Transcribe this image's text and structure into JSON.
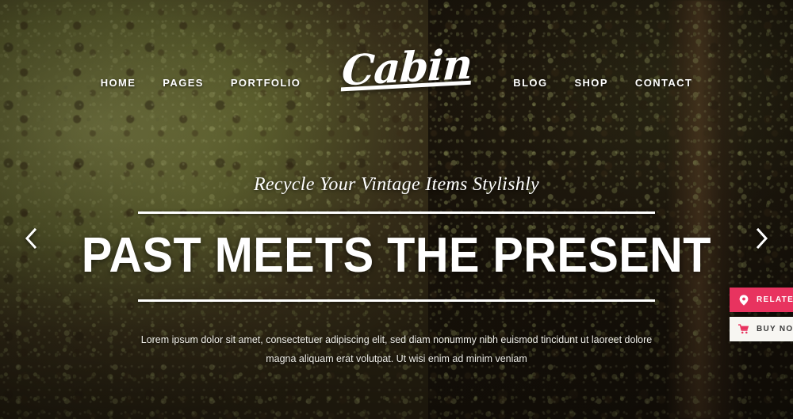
{
  "site": {
    "brand": "Cabin"
  },
  "colors": {
    "accent_pink": "#e8335f",
    "buy_bg": "#f7f6f2",
    "buy_text": "#3a3a3a",
    "text_white": "#ffffff"
  },
  "header": {
    "nav_left": [
      {
        "label": "HOME",
        "name": "nav-item-home"
      },
      {
        "label": "PAGES",
        "name": "nav-item-pages"
      },
      {
        "label": "PORTFOLIO",
        "name": "nav-item-portfolio"
      }
    ],
    "nav_right": [
      {
        "label": "BLOG",
        "name": "nav-item-blog"
      },
      {
        "label": "SHOP",
        "name": "nav-item-shop"
      },
      {
        "label": "CONTACT",
        "name": "nav-item-contact"
      }
    ]
  },
  "slide": {
    "tagline": "Recycle Your Vintage Items Stylishly",
    "title": "PAST MEETS THE PRESENT",
    "description": "Lorem ipsum dolor sit amet, consectetuer adipiscing elit, sed diam nonummy nibh euismod tincidunt ut laoreet dolore magna aliquam erat volutpat. Ut wisi enim ad minim veniam"
  },
  "slider_controls": {
    "prev_icon": "chevron-left-icon",
    "next_icon": "chevron-right-icon"
  },
  "side_actions": [
    {
      "label": "RELATED",
      "icon": "location-pin-icon",
      "name": "related-button"
    },
    {
      "label": "BUY NOW",
      "icon": "shopping-cart-icon",
      "name": "buy-now-button"
    }
  ]
}
